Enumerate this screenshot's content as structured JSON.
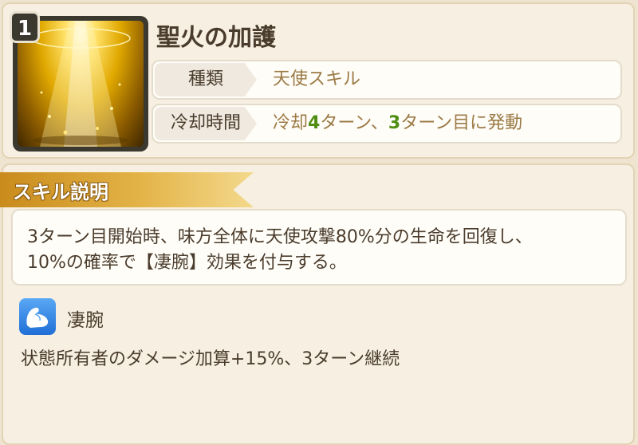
{
  "skill": {
    "level": "1",
    "name": "聖火の加護",
    "icon": "holy-light-icon"
  },
  "info": {
    "type_label": "種類",
    "type_value": "天使スキル",
    "cooldown_label": "冷却時間",
    "cooldown_value": {
      "prefix": "冷却",
      "turns": "4",
      "middle": "ターン、",
      "start_turn": "3",
      "suffix": "ターン目に発動"
    }
  },
  "description": {
    "header": "スキル説明",
    "lines": [
      "3ターン目開始時、味方全体に天使攻撃80%分の生命を回復し、",
      "10%の確率で【凄腕】効果を付与する。"
    ]
  },
  "effect": {
    "icon": "flexed-arm-icon",
    "name": "凄腕",
    "description": "状態所有者のダメージ加算+15%、3ターン継続"
  },
  "colors": {
    "accent_value": "#9b7a45",
    "number_green": "#4f8e12",
    "banner_gold": "#d9a33a"
  }
}
